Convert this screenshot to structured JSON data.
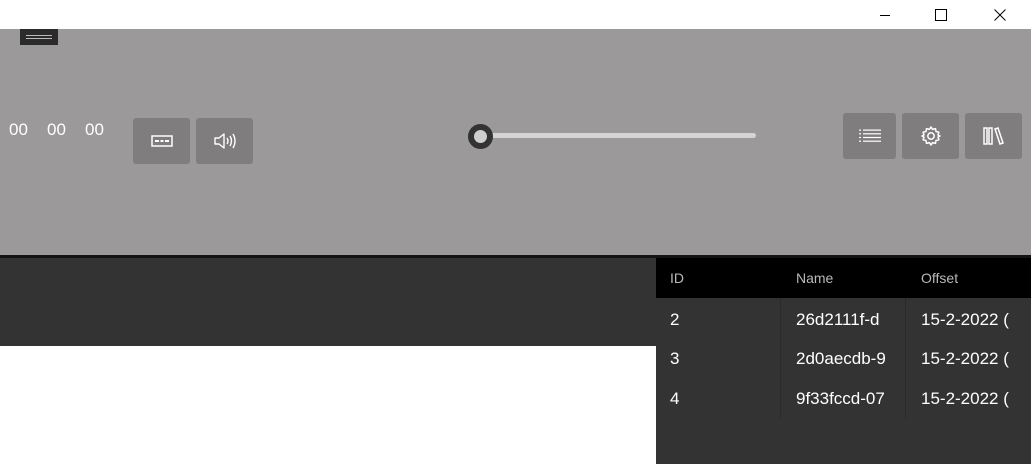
{
  "window_controls": {
    "minimize_icon": "minimize-icon",
    "maximize_icon": "maximize-icon",
    "close_icon": "close-icon"
  },
  "menu": {
    "icon": "hamburger-menu-icon"
  },
  "timecode": {
    "hours": "00",
    "minutes": "00",
    "seconds": "00"
  },
  "buttons": {
    "subtitle_icon": "subtitles-icon",
    "volume_icon": "volume-icon",
    "playlist_icon": "list-icon",
    "settings_icon": "gear-icon",
    "library_icon": "library-icon"
  },
  "seek": {
    "position": 0
  },
  "table": {
    "columns": [
      "ID",
      "Name",
      "Offset"
    ],
    "rows": [
      {
        "id": "2",
        "name": "26d2111f-d",
        "offset": "15-2-2022 ("
      },
      {
        "id": "3",
        "name": "2d0aecdb-9",
        "offset": "15-2-2022 ("
      },
      {
        "id": "4",
        "name": "9f33fccd-07",
        "offset": "15-2-2022 ("
      }
    ]
  },
  "colors": {
    "control_bar": "#9b999a",
    "button_bg": "#7f7d7e",
    "panel_bg": "#333333",
    "header_bg": "#000000"
  }
}
